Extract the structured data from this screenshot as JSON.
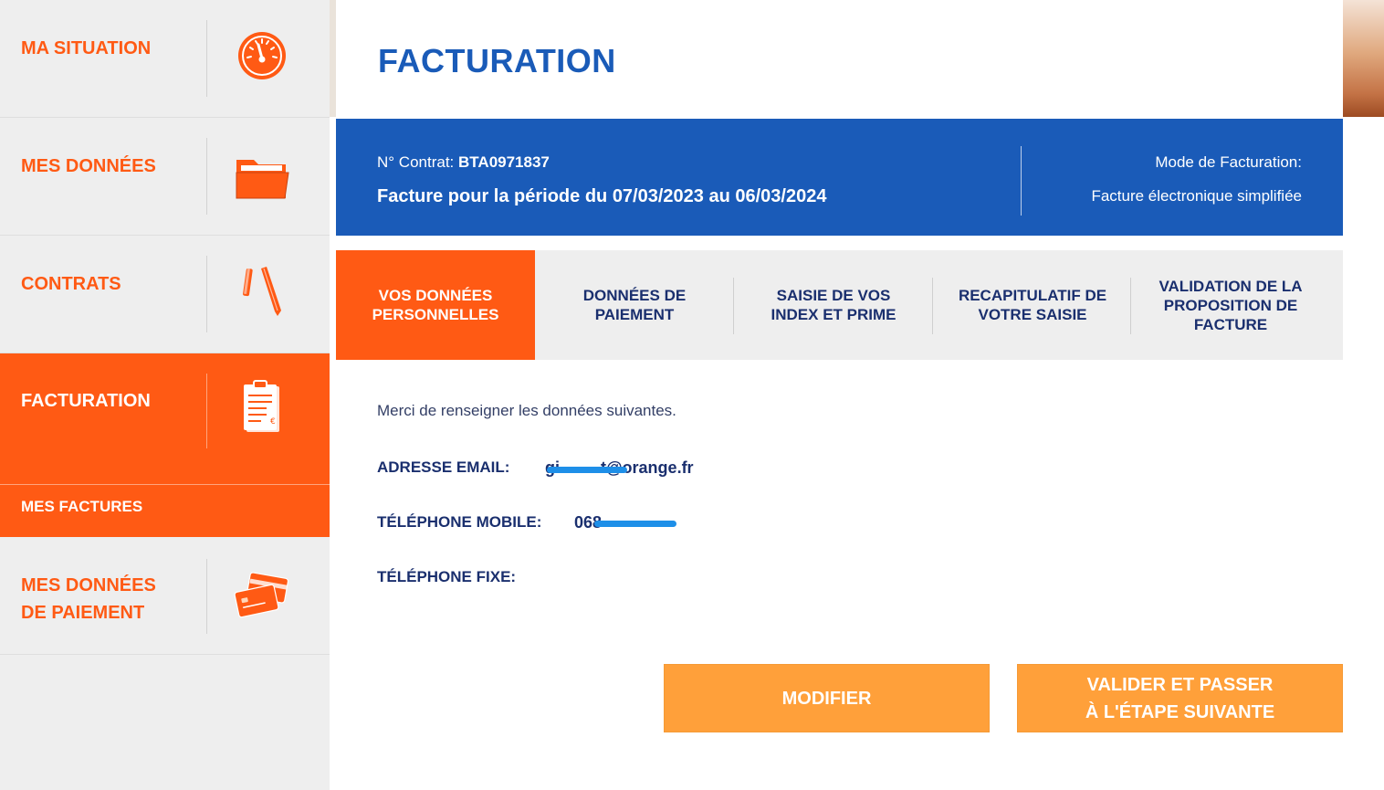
{
  "sidebar": {
    "items": [
      {
        "label": "MA SITUATION",
        "icon": "gauge-icon"
      },
      {
        "label": "MES DONNÉES",
        "icon": "folder-icon"
      },
      {
        "label": "CONTRATS",
        "icon": "pen-icon"
      },
      {
        "label": "FACTURATION",
        "icon": "clipboard-invoice-icon",
        "active": true
      },
      {
        "label_line1": "MES DONNÉES",
        "label_line2": "DE PAIEMENT",
        "icon": "credit-cards-icon"
      }
    ],
    "sub_item": {
      "label": "MES FACTURES"
    }
  },
  "header": {
    "title": "FACTURATION"
  },
  "banner": {
    "contract_label": "N° Contrat:",
    "contract_number": "BTA0971837",
    "period": "Facture pour la période du 07/03/2023 au 06/03/2024",
    "mode_label": "Mode de Facturation:",
    "mode_value": "Facture électronique simplifiée"
  },
  "steps": [
    {
      "line1": "VOS DONNÉES",
      "line2": "PERSONNELLES",
      "active": true
    },
    {
      "line1": "DONNÉES DE",
      "line2": "PAIEMENT"
    },
    {
      "line1": "SAISIE DE VOS",
      "line2": "INDEX ET PRIME"
    },
    {
      "line1": "RECAPITULATIF DE",
      "line2": "VOTRE SAISIE"
    },
    {
      "line1": "VALIDATION DE LA",
      "line2": "PROPOSITION DE",
      "line3": "FACTURE"
    }
  ],
  "form": {
    "intro": "Merci de renseigner les données suivantes.",
    "email_label": "ADRESSE EMAIL:",
    "email_value": "gi         t@orange.fr",
    "mobile_label": "TÉLÉPHONE MOBILE:",
    "mobile_value": "068",
    "fixe_label": "TÉLÉPHONE FIXE:"
  },
  "buttons": {
    "modify": "MODIFIER",
    "next_line1": "VALIDER ET PASSER",
    "next_line2": "À L'ÉTAPE SUIVANTE"
  },
  "colors": {
    "brand_orange": "#ff5a14",
    "brand_blue": "#1a5bb8",
    "button_orange": "#ffa03a",
    "navy_text": "#1a2f6e",
    "redaction_blue": "#1e8fe8"
  }
}
